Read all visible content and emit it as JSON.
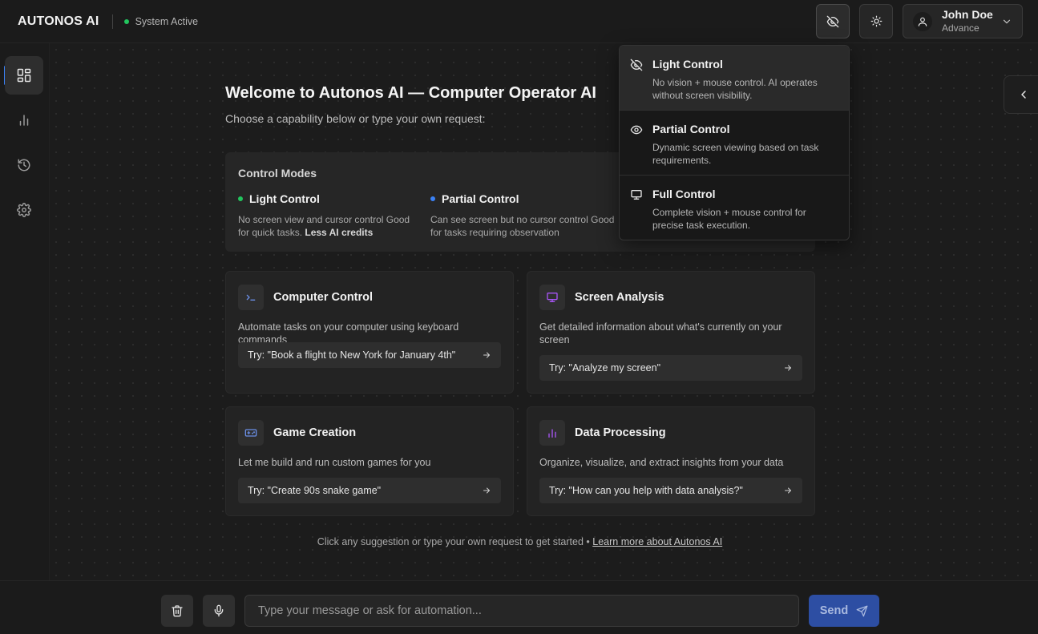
{
  "header": {
    "brand": "AUTONOS AI",
    "status": "System Active",
    "status_color": "#22c55e",
    "vision_toggle_icon": "eye-off-icon",
    "theme_toggle_icon": "sun-icon",
    "user": {
      "name": "John Doe",
      "role": "Advance"
    }
  },
  "sidebar": {
    "items": [
      {
        "icon": "dashboard-icon",
        "active": true
      },
      {
        "icon": "bar-chart-icon",
        "active": false
      },
      {
        "icon": "history-icon",
        "active": false
      },
      {
        "icon": "gear-icon",
        "active": false
      }
    ]
  },
  "main": {
    "title": "Welcome to Autonos AI — Computer Operator AI",
    "subtitle": "Choose a capability below or type your own request:",
    "modes": {
      "title": "Control Modes",
      "items": [
        {
          "label": "Light Control",
          "color": "#22c55e",
          "desc": "No screen view and cursor control Good for quick tasks.",
          "desc_bold": "Less AI credits"
        },
        {
          "label": "Partial Control",
          "color": "#3b82f6",
          "desc": "Can see screen but no cursor control Good for tasks requiring observation",
          "desc_bold": ""
        }
      ]
    },
    "cards": [
      {
        "title": "Computer Control",
        "icon": "terminal-icon",
        "desc": "Automate tasks on your computer using keyboard commands",
        "try": "Try: \"Book a flight to New York for January 4th\""
      },
      {
        "title": "Screen Analysis",
        "icon": "monitor-icon",
        "desc": "Get detailed information about what's currently on your screen",
        "try": "Try: \"Analyze my screen\""
      },
      {
        "title": "Game Creation",
        "icon": "gamepad-icon",
        "desc": "Let me build and run custom games for you",
        "try": "Try: \"Create 90s snake game\""
      },
      {
        "title": "Data Processing",
        "icon": "bar-chart-icon",
        "desc": "Organize, visualize, and extract insights from your data",
        "try": "Try: \"How can you help with data analysis?\""
      }
    ],
    "footer_text": "Click any suggestion or type your own request to get started •",
    "footer_link": "Learn more about Autonos AI"
  },
  "dropdown": {
    "items": [
      {
        "title": "Light Control",
        "icon": "eye-off-icon",
        "desc": "No vision + mouse control. AI operates without screen visibility.",
        "selected": true
      },
      {
        "title": "Partial Control",
        "icon": "eye-icon",
        "desc": "Dynamic screen viewing based on task requirements.",
        "selected": false
      },
      {
        "title": "Full Control",
        "icon": "monitor-icon",
        "desc": "Complete vision + mouse control for precise task execution.",
        "selected": false
      }
    ]
  },
  "input": {
    "placeholder": "Type your message or ask for automation...",
    "value": "",
    "send_label": "Send",
    "send_color": "#2d4ea3"
  }
}
